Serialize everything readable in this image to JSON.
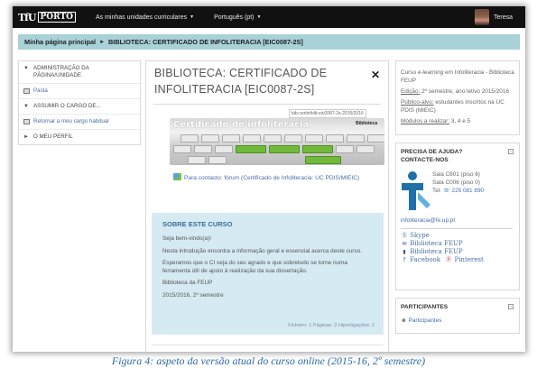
{
  "navbar": {
    "logo_mark": "TfU",
    "logo_text": "PORTO",
    "links": [
      {
        "label": "As minhas unidades curriculares"
      },
      {
        "label": "Português (pt)"
      }
    ],
    "user_name": "Teresa"
  },
  "breadcrumb": {
    "home": "Minha página principal",
    "current": "BIBLIOTECA: CERTIFICADO DE INFOLITERACIA [EIC0087-2S]"
  },
  "left_block": {
    "items": [
      {
        "label": "ADMINISTRAÇÃO DA PÁGINA/UNIDADE",
        "icon": "chevron-down-icon"
      },
      {
        "label": "Pasta",
        "icon": "folder-icon"
      },
      {
        "label": "ASSUMIR O CARGO DE...",
        "icon": "chevron-down-icon"
      },
      {
        "label": "Retornar a meu cargo habitual",
        "icon": "return-icon"
      },
      {
        "label": "O MEU PERFIL",
        "icon": "chevron-right-icon"
      }
    ]
  },
  "course": {
    "title": "BIBLIOTECA: CERTIFICADO DE INFOLITERACIA [EIC0087-2S]",
    "banner_tag": "bib-certinfolit-eic0087-2s-2015/2016",
    "banner_title": "Certificado de infoliteracia",
    "banner_logo": "Biblioteca",
    "contact": "Para contacto: fórum (Certificado de Infoliteracia: UC PDIS/MIEIC)"
  },
  "about": {
    "heading": "SOBRE ESTE CURSO",
    "paragraphs": [
      "Seja bem-vindo(a)!",
      "Nesta introdução encontra a informação geral e essencial acerca deste curso.",
      "Esperamos que o CI seja do seu agrado e que sobretudo se torne numa ferramenta útil de apoio à realização da sua dissertação.",
      "Biblioteca da FEUP",
      "2015/2016, 2º semestre"
    ],
    "footer": "Ficheiro: 1  Páginas: 2  Hiperligações: 2"
  },
  "info": {
    "line1_prefix": "Curso ",
    "line1_em": "e-learning",
    "line1_suffix": " em Infoliteracia - Biblioteca FEUP",
    "edition_label": "Edição:",
    "edition_value": " 2º semestre, ano letivo 2015/2016",
    "audience_label": "Público-alvo:",
    "audience_value": " estudantes inscritos na UC PDIS (MIEIC)",
    "modules_label": "Módulos a realizar:",
    "modules_value": " 3, 4 e 5"
  },
  "help": {
    "heading": "PRECISA DE AJUDA? CONTACTE-NOS",
    "room1": "Sala C601 (piso 6)",
    "room2": "Sala C006 (piso 0)",
    "tel_label": "Tel:",
    "tel_value": "225 081 890",
    "email": "infoliteracia@fe.up.pt",
    "social": [
      {
        "label": "Skype",
        "icon": "skype-icon"
      },
      {
        "label": "Biblioteca FEUP",
        "icon": "mail-icon"
      },
      {
        "label": "Biblioteca FEUP",
        "icon": "bookmark-icon"
      },
      {
        "label": "Facebook",
        "icon": "facebook-icon"
      },
      {
        "label": "Pinterest",
        "icon": "pinterest-icon"
      }
    ]
  },
  "participants": {
    "heading": "PARTICIPANTES",
    "link": "Participantes"
  },
  "caption": "Figura 4: aspeto da versão atual do curso online (2015-16, 2º semestre)",
  "colors": {
    "navbar": "#111111",
    "breadcrumb_bg": "#a8d1d8",
    "about_bg": "#d6eaf4",
    "link": "#4a6da7",
    "caption": "#2c6aa6"
  }
}
